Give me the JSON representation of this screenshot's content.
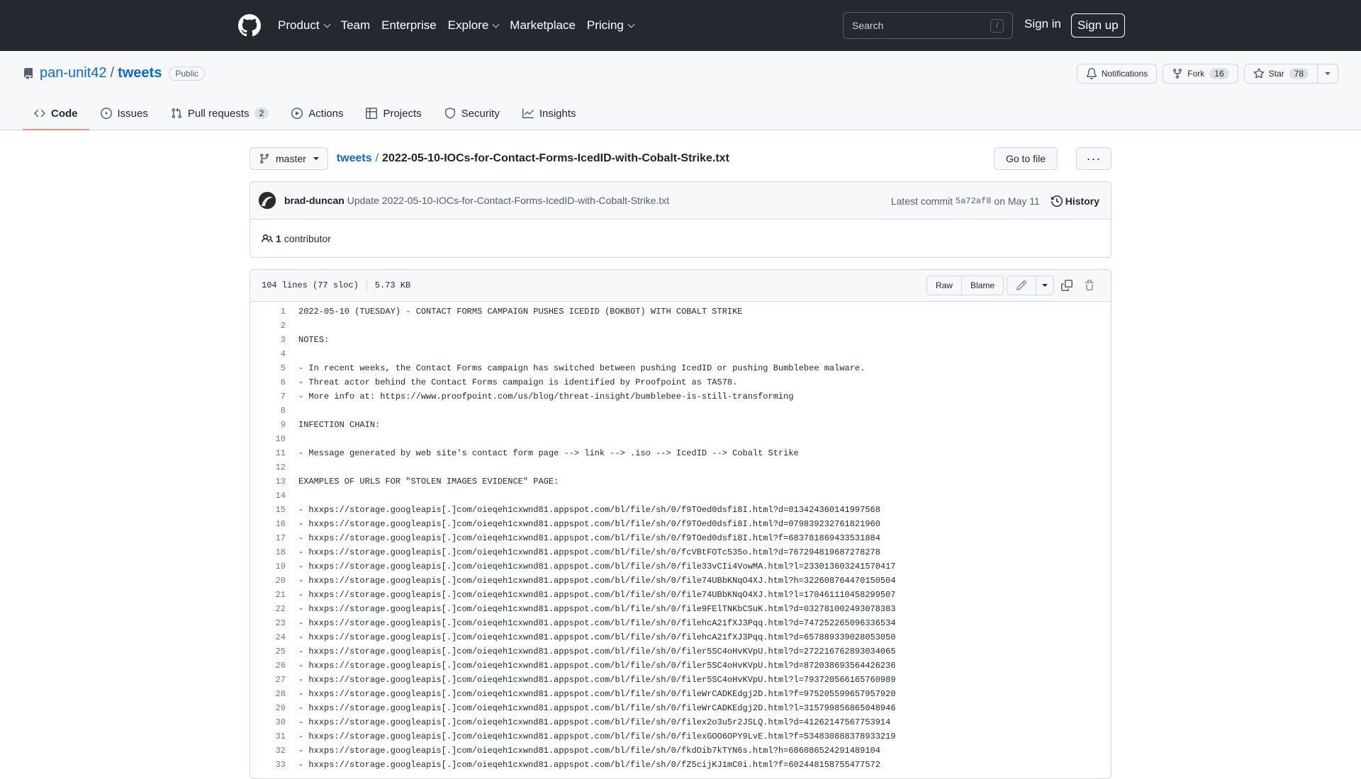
{
  "header": {
    "nav": [
      {
        "label": "Product",
        "dropdown": true
      },
      {
        "label": "Team",
        "dropdown": false
      },
      {
        "label": "Enterprise",
        "dropdown": false
      },
      {
        "label": "Explore",
        "dropdown": true
      },
      {
        "label": "Marketplace",
        "dropdown": false
      },
      {
        "label": "Pricing",
        "dropdown": true
      }
    ],
    "search_placeholder": "Search",
    "search_shortcut": "/",
    "signin": "Sign in",
    "signup": "Sign up"
  },
  "repo": {
    "owner": "pan-unit42",
    "separator": "/",
    "name": "tweets",
    "visibility": "Public",
    "notifications": "Notifications",
    "fork_label": "Fork",
    "fork_count": "16",
    "star_label": "Star",
    "star_count": "78",
    "tabs": [
      {
        "label": "Code",
        "icon": "code-icon",
        "active": true,
        "counter": ""
      },
      {
        "label": "Issues",
        "icon": "issue-icon",
        "active": false,
        "counter": ""
      },
      {
        "label": "Pull requests",
        "icon": "pull-request-icon",
        "active": false,
        "counter": "2"
      },
      {
        "label": "Actions",
        "icon": "play-icon",
        "active": false,
        "counter": ""
      },
      {
        "label": "Projects",
        "icon": "table-icon",
        "active": false,
        "counter": ""
      },
      {
        "label": "Security",
        "icon": "shield-icon",
        "active": false,
        "counter": ""
      },
      {
        "label": "Insights",
        "icon": "graph-icon",
        "active": false,
        "counter": ""
      }
    ]
  },
  "file": {
    "branch": "master",
    "repo_link": "tweets",
    "separator": "/",
    "filename": "2022-05-10-IOCs-for-Contact-Forms-IcedID-with-Cobalt-Strike.txt",
    "goto": "Go to file",
    "more": "···"
  },
  "commit": {
    "author": "brad-duncan",
    "message": "Update 2022-05-10-IOCs-for-Contact-Forms-IcedID-with-Cobalt-Strike.txt",
    "latest_label": "Latest commit",
    "sha": "5a72af8",
    "date": "on May 11",
    "history": "History",
    "contributor_count": "1",
    "contributor_label": "contributor"
  },
  "file_info": {
    "lines": "104 lines (77 sloc)",
    "size": "5.73 KB",
    "raw": "Raw",
    "blame": "Blame"
  },
  "code_lines": [
    "2022-05-10 (TUESDAY) - CONTACT FORMS CAMPAIGN PUSHES ICEDID (BOKBOT) WITH COBALT STRIKE",
    "",
    "NOTES:",
    "",
    "- In recent weeks, the Contact Forms campaign has switched between pushing IcedID or pushing Bumblebee malware.",
    "- Threat actor behind the Contact Forms campaign is identified by Proofpoint as TA578.",
    "- More info at: https://www.proofpoint.com/us/blog/threat-insight/bumblebee-is-still-transforming",
    "",
    "INFECTION CHAIN:",
    "",
    "- Message generated by web site's contact form page --> link --> .iso --> IcedID --> Cobalt Strike",
    "",
    "EXAMPLES OF URLS FOR \"STOLEN IMAGES EVIDENCE\" PAGE:",
    "",
    "- hxxps://storage.googleapis[.]com/oieqeh1cxwnd81.appspot.com/bl/file/sh/0/f9TOed0dsfi8I.html?d=013424360141997568",
    "- hxxps://storage.googleapis[.]com/oieqeh1cxwnd81.appspot.com/bl/file/sh/0/f9TOed0dsfi8I.html?d=079839232761821960",
    "- hxxps://storage.googleapis[.]com/oieqeh1cxwnd81.appspot.com/bl/file/sh/0/f9TOed0dsfi8I.html?f=683781869433531884",
    "- hxxps://storage.googleapis[.]com/oieqeh1cxwnd81.appspot.com/bl/file/sh/0/fcVBtFOTc535o.html?d=767294819687278278",
    "- hxxps://storage.googleapis[.]com/oieqeh1cxwnd81.appspot.com/bl/file/sh/0/file33vCIi4VowMA.html?l=233013603241570417",
    "- hxxps://storage.googleapis[.]com/oieqeh1cxwnd81.appspot.com/bl/file/sh/0/file74UBbKNqO4XJ.html?h=322608764470150504",
    "- hxxps://storage.googleapis[.]com/oieqeh1cxwnd81.appspot.com/bl/file/sh/0/file74UBbKNqO4XJ.html?l=170461110458299507",
    "- hxxps://storage.googleapis[.]com/oieqeh1cxwnd81.appspot.com/bl/file/sh/0/file9FElTNKbCSuK.html?d=032781002493078383",
    "- hxxps://storage.googleapis[.]com/oieqeh1cxwnd81.appspot.com/bl/file/sh/0/filehcA21fXJ3Pqq.html?d=747252265096336534",
    "- hxxps://storage.googleapis[.]com/oieqeh1cxwnd81.appspot.com/bl/file/sh/0/filehcA21fXJ3Pqq.html?d=657889339028053050",
    "- hxxps://storage.googleapis[.]com/oieqeh1cxwnd81.appspot.com/bl/file/sh/0/filer5SC4oHvKVpU.html?d=272216762893034065",
    "- hxxps://storage.googleapis[.]com/oieqeh1cxwnd81.appspot.com/bl/file/sh/0/filer5SC4oHvKVpU.html?d=872038693564426236",
    "- hxxps://storage.googleapis[.]com/oieqeh1cxwnd81.appspot.com/bl/file/sh/0/filer5SC4oHvKVpU.html?l=793720566165760989",
    "- hxxps://storage.googleapis[.]com/oieqeh1cxwnd81.appspot.com/bl/file/sh/0/fileWrCADKEdgj2D.html?f=975205599657957920",
    "- hxxps://storage.googleapis[.]com/oieqeh1cxwnd81.appspot.com/bl/file/sh/0/fileWrCADKEdgj2D.html?l=315799856865048946",
    "- hxxps://storage.googleapis[.]com/oieqeh1cxwnd81.appspot.com/bl/file/sh/0/filex2o3u5r2JSLQ.html?d=41262147567753914",
    "- hxxps://storage.googleapis[.]com/oieqeh1cxwnd81.appspot.com/bl/file/sh/0/filexGOO6OPY9LvE.html?f=534830888378933219",
    "- hxxps://storage.googleapis[.]com/oieqeh1cxwnd81.appspot.com/bl/file/sh/0/fkdOib7kTYN6s.html?h=686086524291489104",
    "- hxxps://storage.googleapis[.]com/oieqeh1cxwnd81.appspot.com/bl/file/sh/0/fZ5cijKJ1mC0i.html?f=602448158755477572"
  ]
}
